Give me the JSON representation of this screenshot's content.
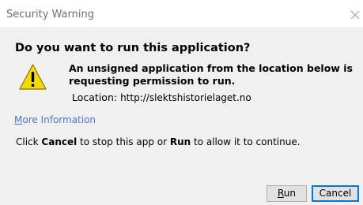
{
  "window": {
    "title": "Security Warning"
  },
  "dialog": {
    "question": "Do you want to run this application?",
    "description": "An unsigned application from the location below is requesting permission to run.",
    "location_label": "Location:",
    "location_value": "http://slektshistorielaget.no",
    "more_info_first": "M",
    "more_info_rest": "ore Information",
    "instruction_part1": "Click ",
    "instruction_cancel": "Cancel",
    "instruction_part2": " to stop this app or ",
    "instruction_run": "Run",
    "instruction_part3": " to allow it to continue."
  },
  "buttons": {
    "run_first": "R",
    "run_rest": "un",
    "cancel": "Cancel"
  },
  "icons": {
    "close": "close-icon",
    "warning": "warning-icon"
  },
  "colors": {
    "link": "#4a77c9",
    "focus_border": "#0078d7",
    "warning_yellow": "#f5d90a"
  }
}
